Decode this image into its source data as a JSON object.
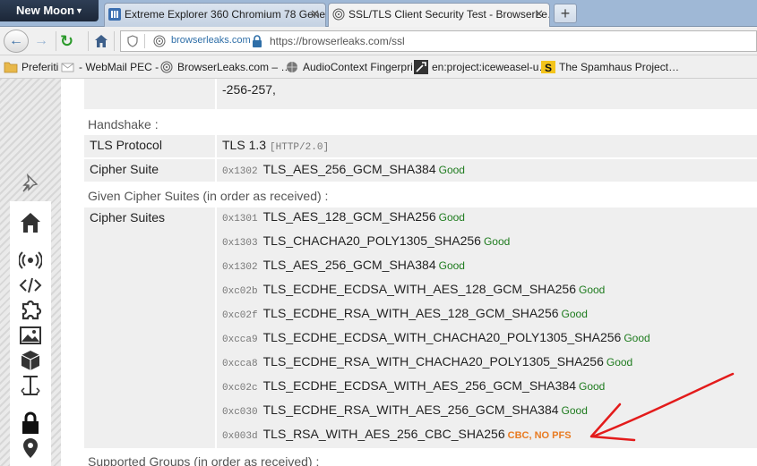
{
  "browser": {
    "menu_label": "New Moon",
    "tabs": [
      {
        "title": "Extreme Explorer 360 Chromium 78 Gener…",
        "active": false
      },
      {
        "title": "SSL/TLS Client Security Test - BrowserLe…",
        "active": true
      }
    ],
    "new_tab_label": "+",
    "close_glyph": "✕"
  },
  "navbar": {
    "back_glyph": "←",
    "forward_glyph": "→",
    "reload_glyph": "↻",
    "identity_domain": "browserleaks.com",
    "url": "https://browserleaks.com/ssl"
  },
  "bookmarks": [
    {
      "label": "Preferiti",
      "icon": "folder-icon"
    },
    {
      "label": "- WebMail PEC -",
      "icon": "mail-icon"
    },
    {
      "label": "BrowserLeaks.com – …",
      "icon": "fingerprint-icon"
    },
    {
      "label": "AudioContext Fingerpri…",
      "icon": "globe-icon"
    },
    {
      "label": "en:project:iceweasel-u…",
      "icon": "wrench-icon"
    },
    {
      "label": "The Spamhaus Project…",
      "icon": "spamhaus-icon"
    }
  ],
  "sidebar_icons": [
    "pin-icon",
    "home-icon",
    "broadcast-icon",
    "code-icon",
    "puzzle-icon",
    "image-icon",
    "cube-icon",
    "text-cursor-icon",
    "lock-icon",
    "location-icon"
  ],
  "content": {
    "top_value": "-256-257,",
    "handshake_heading": "Handshake :",
    "tls_protocol_label": "TLS Protocol",
    "tls_protocol_value": "TLS 1.3",
    "tls_protocol_http": "[HTTP/2.0]",
    "cipher_suite_label": "Cipher Suite",
    "cipher_suite_hex": "0x1302",
    "cipher_suite_name": "TLS_AES_256_GCM_SHA384",
    "cipher_suite_status": "Good",
    "given_heading": "Given Cipher Suites (in order as received) :",
    "cipher_suites_label": "Cipher Suites",
    "suites": [
      {
        "hex": "0x1301",
        "name": "TLS_AES_128_GCM_SHA256",
        "status": "Good"
      },
      {
        "hex": "0x1303",
        "name": "TLS_CHACHA20_POLY1305_SHA256",
        "status": "Good"
      },
      {
        "hex": "0x1302",
        "name": "TLS_AES_256_GCM_SHA384",
        "status": "Good"
      },
      {
        "hex": "0xc02b",
        "name": "TLS_ECDHE_ECDSA_WITH_AES_128_GCM_SHA256",
        "status": "Good"
      },
      {
        "hex": "0xc02f",
        "name": "TLS_ECDHE_RSA_WITH_AES_128_GCM_SHA256",
        "status": "Good"
      },
      {
        "hex": "0xcca9",
        "name": "TLS_ECDHE_ECDSA_WITH_CHACHA20_POLY1305_SHA256",
        "status": "Good"
      },
      {
        "hex": "0xcca8",
        "name": "TLS_ECDHE_RSA_WITH_CHACHA20_POLY1305_SHA256",
        "status": "Good"
      },
      {
        "hex": "0xc02c",
        "name": "TLS_ECDHE_ECDSA_WITH_AES_256_GCM_SHA384",
        "status": "Good"
      },
      {
        "hex": "0xc030",
        "name": "TLS_ECDHE_RSA_WITH_AES_256_GCM_SHA384",
        "status": "Good"
      },
      {
        "hex": "0x003d",
        "name": "TLS_RSA_WITH_AES_256_CBC_SHA256",
        "status": "CBC, NO PFS"
      }
    ],
    "supported_groups_heading": "Supported Groups (in order as received) :"
  },
  "colors": {
    "good": "#1e7b1e",
    "warning": "#e87b22",
    "annotation_arrow": "#e31b1b"
  }
}
